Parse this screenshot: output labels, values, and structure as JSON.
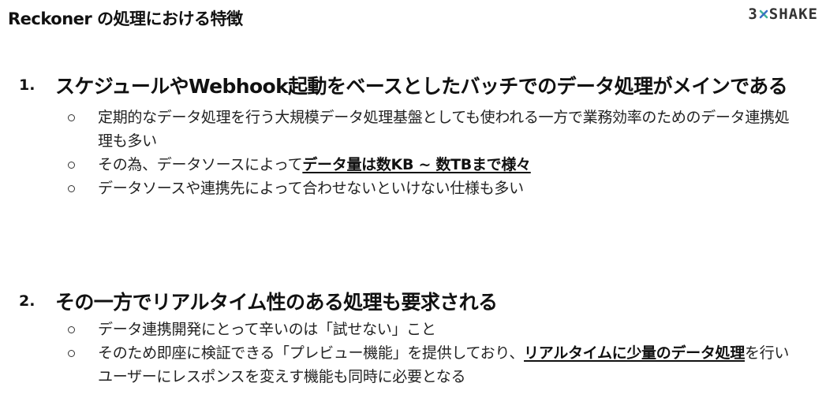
{
  "header": {
    "title": "Reckoner の処理における特徴",
    "logo_left": "3",
    "logo_right": "SHAKE",
    "logo_mark": "3shake-x-logo-icon"
  },
  "points": [
    {
      "num": "1.",
      "heading": "スケジュールやWebhook起動をベースとしたバッチでのデータ処理がメインである",
      "subs": [
        {
          "text": "定期的なデータ処理を行う大規模データ処理基盤としても使われる一方で業務効率のためのデータ連携処理も多い"
        },
        {
          "pre": "その為、データソースによって",
          "emph": "データ量は数KB ~ 数TBまで様々"
        },
        {
          "text": "データソースや連携先によって合わせないといけない仕様も多い"
        }
      ]
    },
    {
      "num": "2.",
      "heading": "その一方でリアルタイム性のある処理も要求される",
      "subs": [
        {
          "text": "データ連携開発にとって辛いのは「試せない」こと"
        },
        {
          "pre": "そのため即座に検証できる「プレビュー機能」を提供しており、",
          "emph": "リアルタイムに少量のデータ処理",
          "post": "を行いユーザーにレスポンスを変えす機能も同時に必要となる"
        }
      ]
    }
  ],
  "colors": {
    "text": "#1a1a1a",
    "logo": "#333333",
    "logo_mark_green": "#3fb39a",
    "logo_mark_blue": "#3a6fc4"
  }
}
